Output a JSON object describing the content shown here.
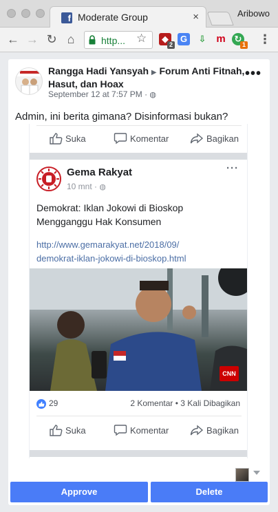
{
  "browser": {
    "tab_title": "Moderate Group",
    "tab_close": "×",
    "profile_name": "Aribowo",
    "url": "http...",
    "star": "☆",
    "ext_badges": {
      "ext1": "2",
      "ext6": "1"
    },
    "menu": "⋮"
  },
  "post": {
    "author": "Rangga Hadi Yansyah",
    "group": "Forum Anti Fitnah, Hasut, dan Hoax",
    "time": "September 12 at 7:57 PM · ",
    "text": "Admin, ini berita gimana? Disinformasi bukan?",
    "more": "•••"
  },
  "shared": {
    "top_actions": {
      "like": "Suka",
      "comment": "Komentar",
      "share": "Bagikan"
    },
    "page_name": "Gema Rakyat",
    "time": "10 mnt · ",
    "more": "···",
    "text_line1": "Demokrat: Iklan Jokowi di Bioskop",
    "text_line2": "Mengganggu Hak Konsumen",
    "link_line1": "http://www.gemarakyat.net/2018/09/",
    "link_line2": "demokrat-iklan-jokowi-di-bioskop.html",
    "photo_logo": "CNN",
    "like_count": "29",
    "stats": "2 Komentar • 3 Kali Dibagikan",
    "bottom_actions": {
      "like": "Suka",
      "comment": "Komentar",
      "share": "Bagikan"
    }
  },
  "moderation": {
    "approve_label": "Approve",
    "delete_label": "Delete",
    "accent_color": "#4a7cf7"
  }
}
